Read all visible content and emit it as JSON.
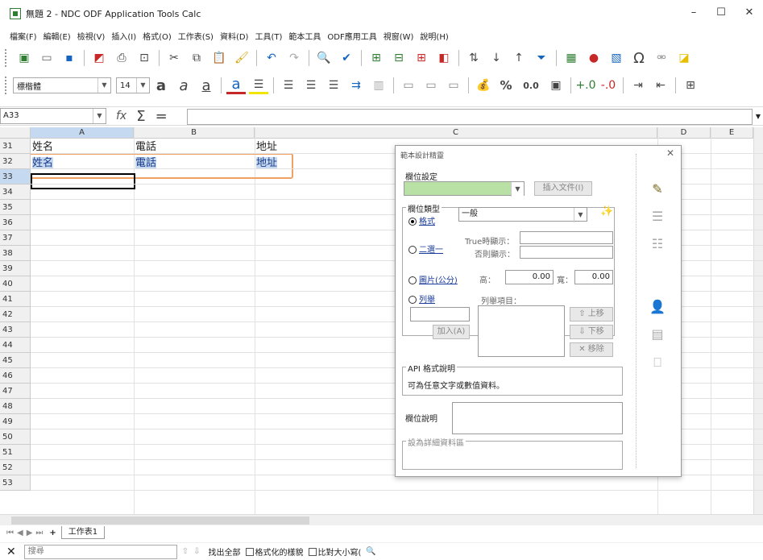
{
  "window": {
    "title": "無題 2 - NDC ODF Application Tools Calc",
    "minimize": "–",
    "maximize": "☐",
    "close": "✕"
  },
  "menu": [
    "檔案(F)",
    "編輯(E)",
    "檢視(V)",
    "插入(I)",
    "格式(O)",
    "工作表(S)",
    "資料(D)",
    "工具(T)",
    "範本工具",
    "ODF應用工具",
    "視窗(W)",
    "說明(H)"
  ],
  "format_toolbar": {
    "font_name": "標楷體",
    "font_size": "14",
    "percent": "%",
    "number": "0.0"
  },
  "formula_bar": {
    "cell_ref": "A33",
    "value": ""
  },
  "columns": [
    "A",
    "B",
    "C",
    "D",
    "E"
  ],
  "rows": [
    "31",
    "32",
    "33",
    "34",
    "35",
    "36",
    "37",
    "38",
    "39",
    "40",
    "41",
    "42",
    "43",
    "44",
    "45",
    "46",
    "47",
    "48",
    "49",
    "50",
    "51",
    "52",
    "53"
  ],
  "cells": {
    "r31": [
      "姓名",
      "電話",
      "地址"
    ],
    "r32": [
      "姓名",
      "電話",
      "地址"
    ]
  },
  "sheet_tabs": {
    "add": "+",
    "current": "工作表1"
  },
  "find_bar": {
    "placeholder": "搜尋",
    "find_all": "找出全部",
    "formatted": "格式化的樣貌",
    "match_case": "比對大小寫("
  },
  "dialog": {
    "title": "範本設計精靈",
    "field_setting": "欄位設定",
    "insert_doc": "插入文件(I)",
    "field_type": "欄位類型",
    "format_label": "格式",
    "format_value": "一般",
    "boolean_label": "二選一",
    "true_display": "True時顯示：",
    "else_display": "否則顯示：",
    "picture_label": "圖片(公分)",
    "height_label": "高：",
    "height_value": "0.00",
    "width_label": "寬：",
    "width_value": "0.00",
    "enum_label": "列舉",
    "enum_items": "列舉項目：",
    "add_btn": "加入(A)",
    "move_up": "上移",
    "move_down": "下移",
    "remove": "移除",
    "api_title": "API 格式說明",
    "api_text": "可為任意文字或數值資料。",
    "field_desc": "欄位說明",
    "detail_area": "設為詳細資料區"
  }
}
